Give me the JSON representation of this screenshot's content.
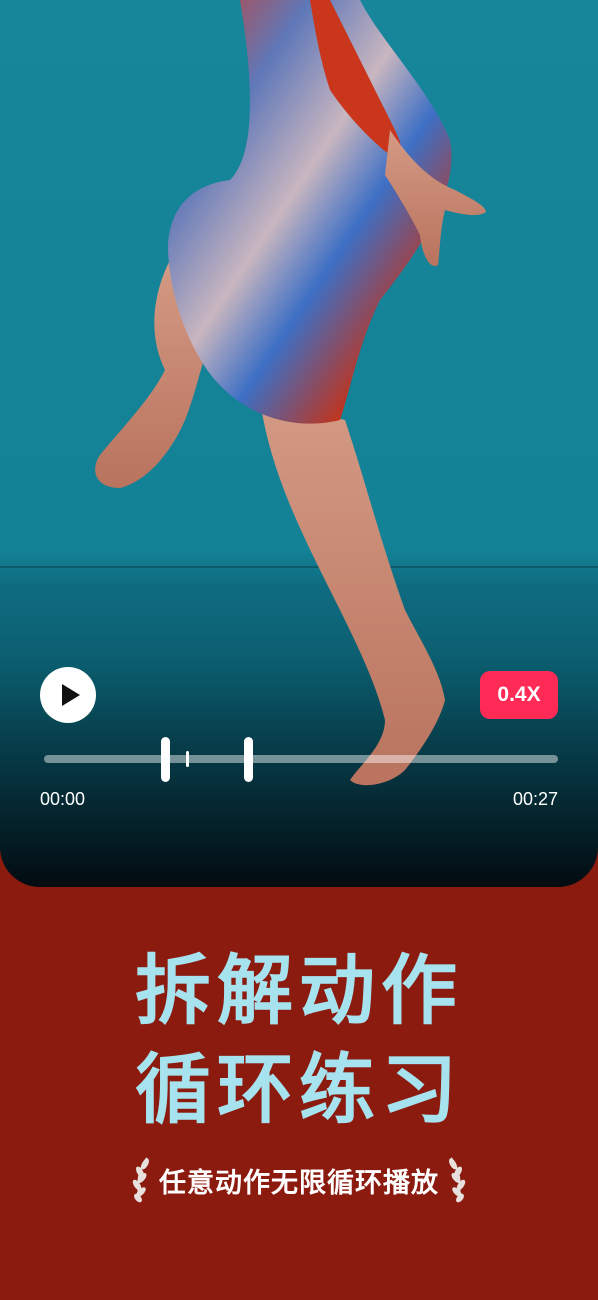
{
  "player": {
    "play_icon": "play-icon",
    "speed_label": "0.4X",
    "time_current": "00:00",
    "time_total": "00:27"
  },
  "promo": {
    "headline_line1": "拆解动作",
    "headline_line2": "循环练习",
    "subtitle": "任意动作无限循环播放",
    "laurel_icon": "laurel-icon"
  },
  "colors": {
    "video_background": "#138196",
    "page_background": "#8b1a0f",
    "speed_badge": "#ff2a55",
    "headline": "#a7e3ef"
  }
}
